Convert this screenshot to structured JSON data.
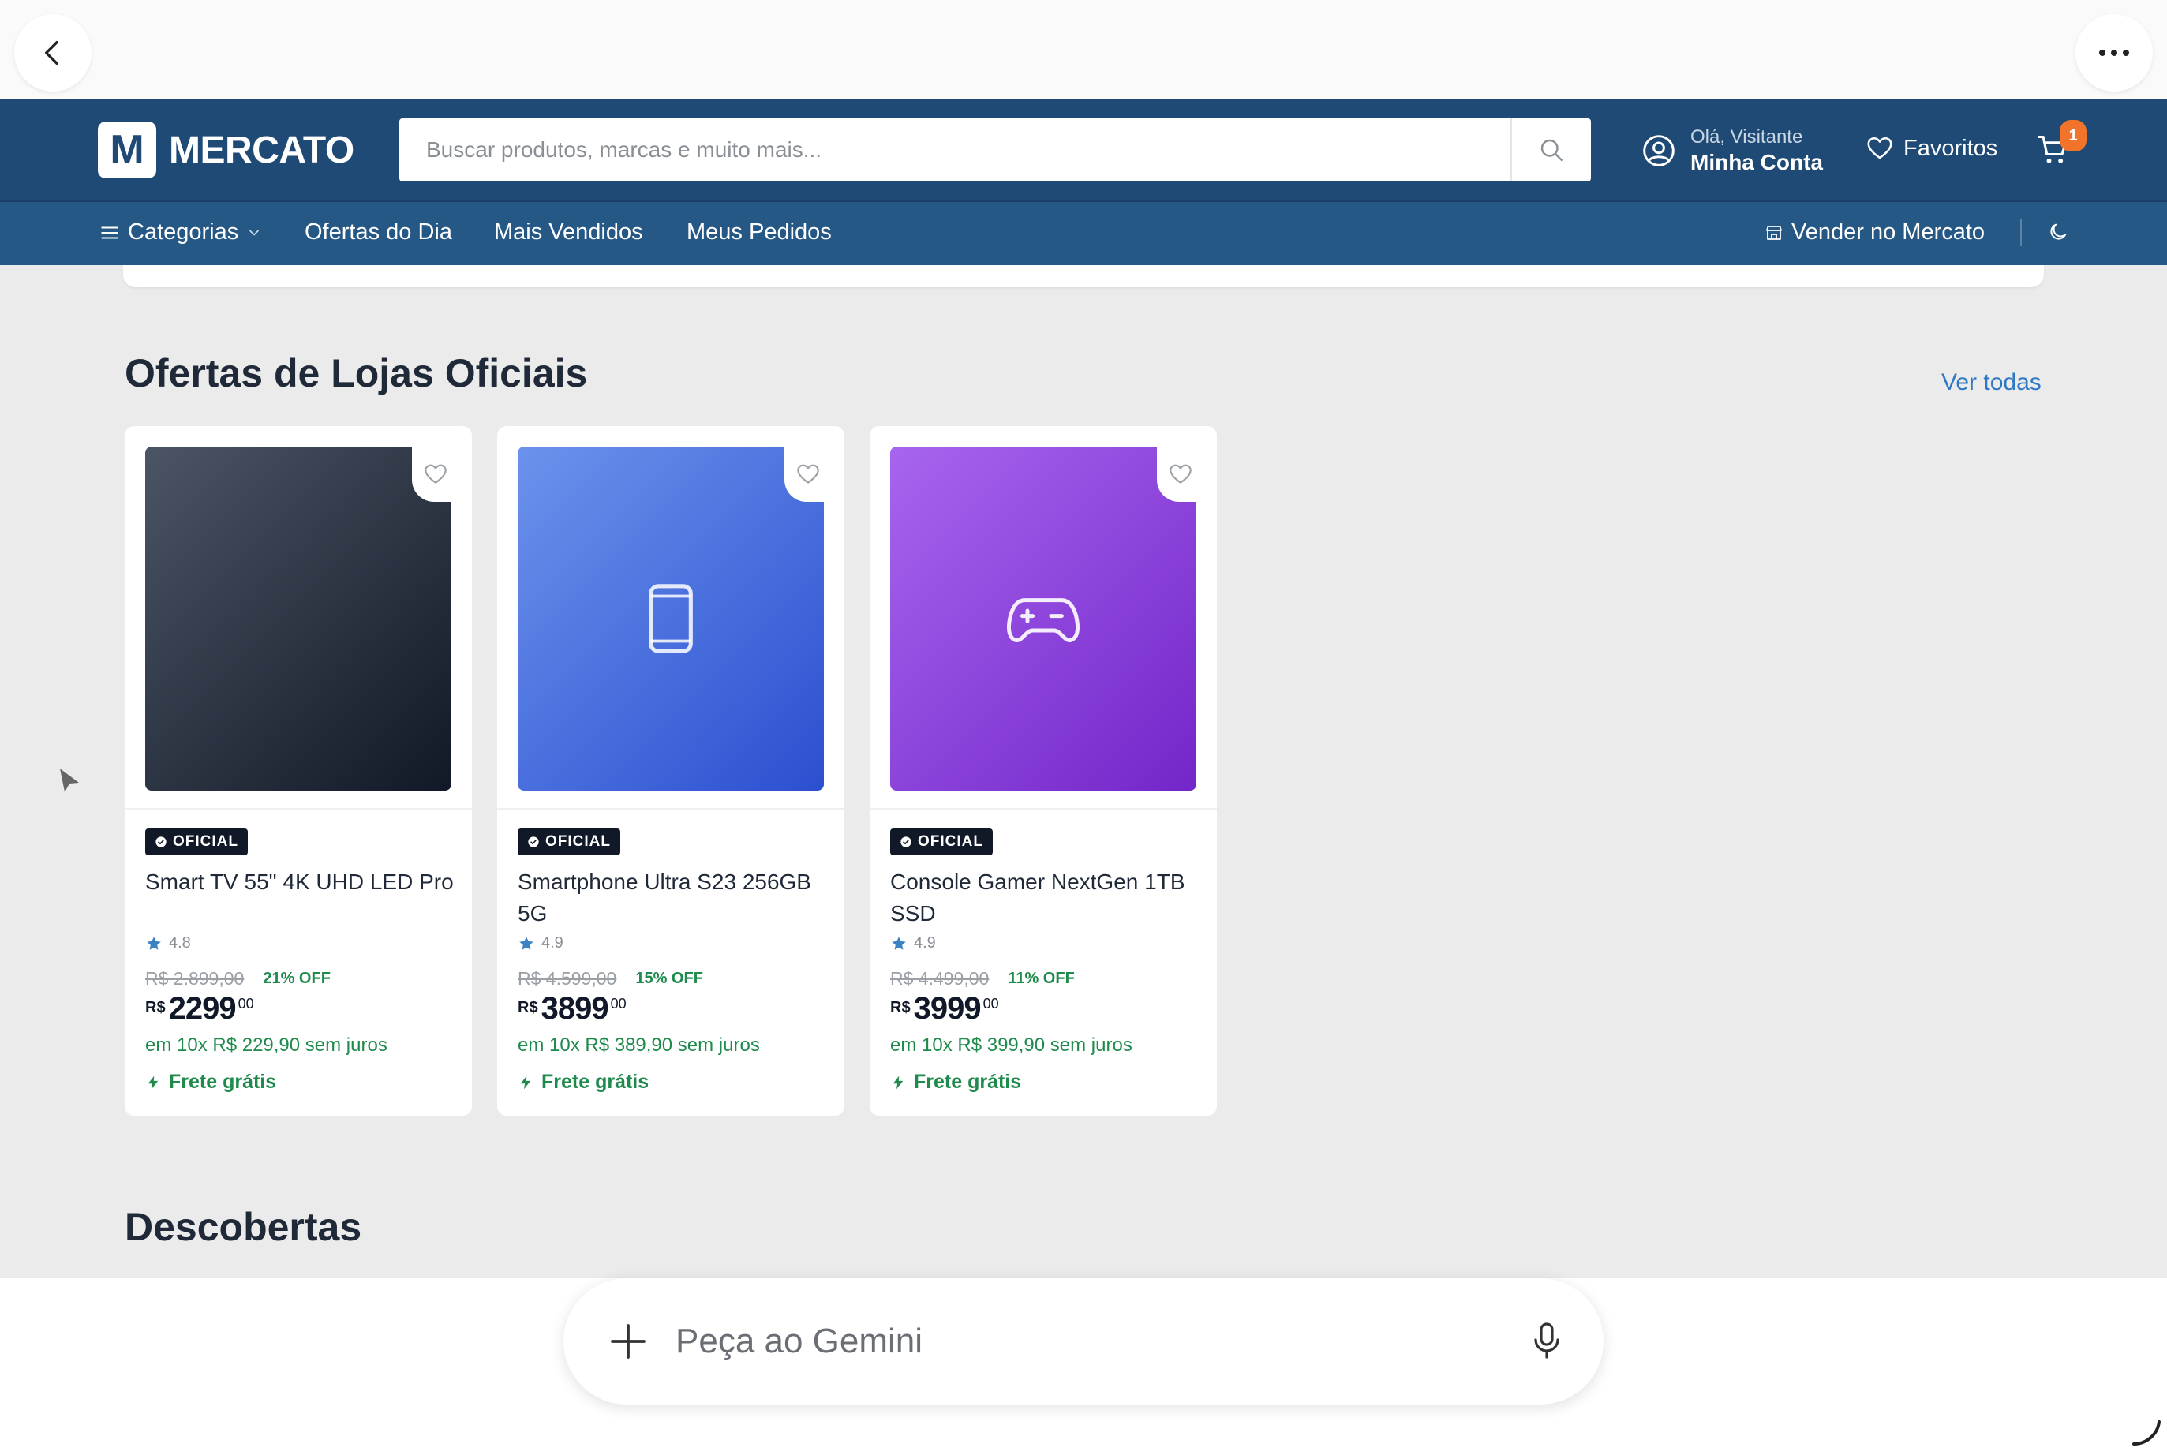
{
  "header": {
    "logo_mark": "M",
    "logo_text": "MERCATO",
    "search_placeholder": "Buscar produtos, marcas e muito mais...",
    "account_greeting": "Olá, Visitante",
    "account_label": "Minha Conta",
    "favorites_label": "Favoritos",
    "cart_count": "1"
  },
  "nav": {
    "categories": "Categorias",
    "deals": "Ofertas do Dia",
    "best_sellers": "Mais Vendidos",
    "orders": "Meus Pedidos",
    "sell": "Vender no Mercato"
  },
  "section_official": {
    "title": "Ofertas de Lojas Oficiais",
    "see_all": "Ver todas"
  },
  "products": [
    {
      "badge": "OFICIAL",
      "name": "Smart TV 55\" 4K UHD LED Pro",
      "rating": "4.8",
      "old_price": "R$ 2.899,00",
      "discount": "21% OFF",
      "currency": "R$",
      "price_int": "2299",
      "price_cents": "00",
      "installments": "em 10x R$ 229,90 sem juros",
      "shipping": "Frete grátis",
      "icon": "none",
      "gradient": [
        "#4b5563",
        "#111827"
      ]
    },
    {
      "badge": "OFICIAL",
      "name": "Smartphone Ultra S23 256GB 5G",
      "rating": "4.9",
      "old_price": "R$ 4.599,00",
      "discount": "15% OFF",
      "currency": "R$",
      "price_int": "3899",
      "price_cents": "00",
      "installments": "em 10x R$ 389,90 sem juros",
      "shipping": "Frete grátis",
      "icon": "smartphone-icon",
      "gradient": [
        "#6b93ec",
        "#2c4fd0"
      ]
    },
    {
      "badge": "OFICIAL",
      "name": "Console Gamer NextGen 1TB SSD",
      "rating": "4.9",
      "old_price": "R$ 4.499,00",
      "discount": "11% OFF",
      "currency": "R$",
      "price_int": "3999",
      "price_cents": "00",
      "installments": "em 10x R$ 399,90 sem juros",
      "shipping": "Frete grátis",
      "icon": "gamepad-icon",
      "gradient": [
        "#a865ee",
        "#7326c9"
      ]
    }
  ],
  "section_discover": {
    "title": "Descobertas"
  },
  "gemini": {
    "placeholder": "Peça ao Gemini"
  },
  "colors": {
    "header": "#1e4a75",
    "nav": "#265886",
    "accent_green": "#1e8a4c",
    "link_blue": "#2f78c4",
    "cart_badge": "#f2742a"
  }
}
